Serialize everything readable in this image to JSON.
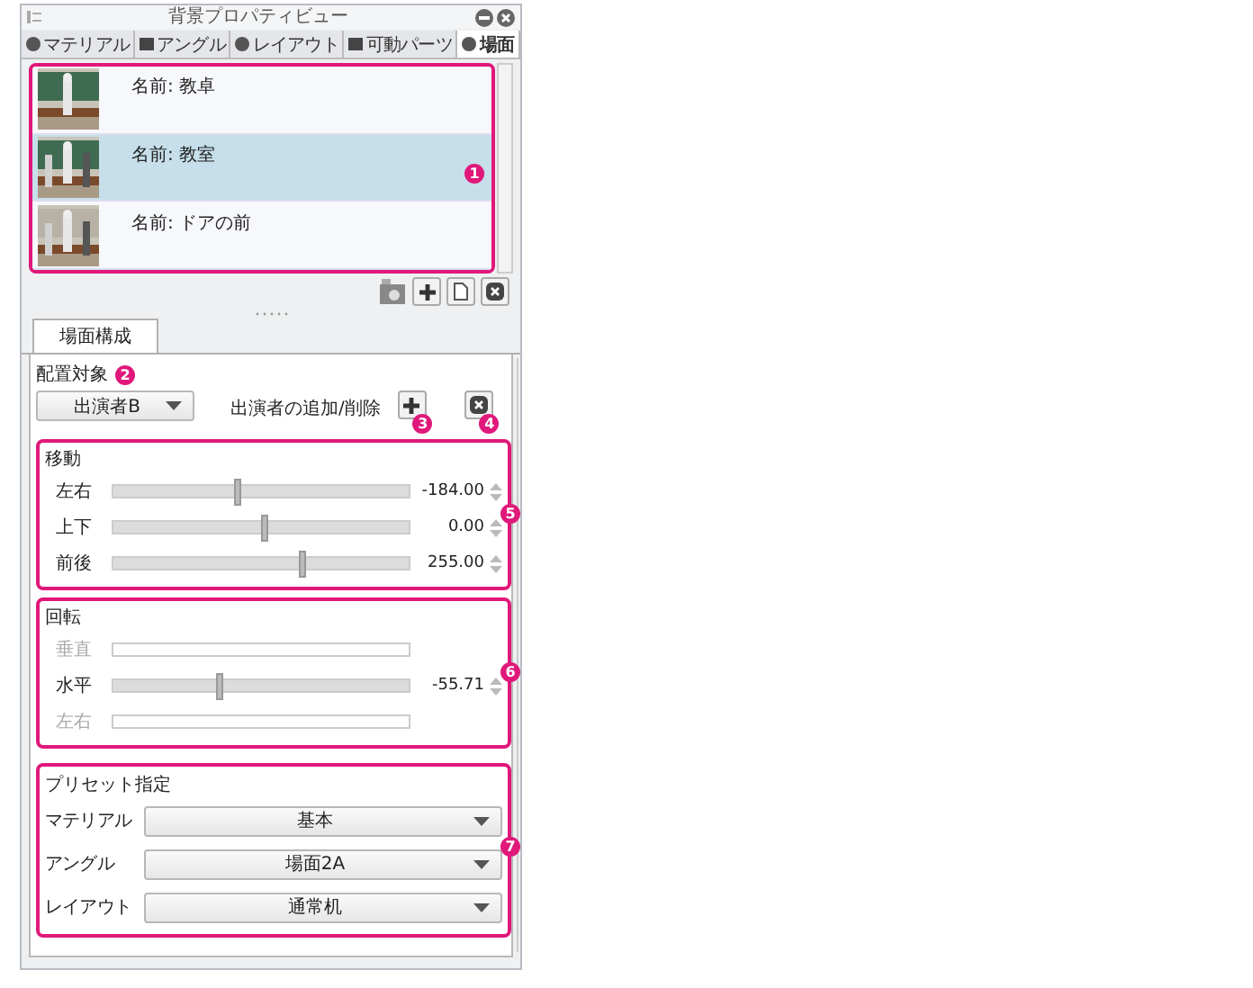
{
  "window": {
    "title": "背景プロパティビュー"
  },
  "tabs": [
    {
      "label": "マテリアル",
      "selected": false
    },
    {
      "label": "アングル",
      "selected": false
    },
    {
      "label": "レイアウト",
      "selected": false
    },
    {
      "label": "可動パーツ",
      "selected": false
    },
    {
      "label": "場面",
      "selected": true
    }
  ],
  "scene_list": {
    "callout": "1",
    "items": [
      {
        "name": "名前: 教卓",
        "selected": false
      },
      {
        "name": "名前: 教室",
        "selected": true
      },
      {
        "name": "名前: ドアの前",
        "selected": false
      }
    ]
  },
  "section_tab": {
    "label": "場面構成"
  },
  "placement": {
    "label": "配置対象",
    "callout": "2",
    "performer": "出演者B",
    "add_remove_label": "出演者の追加/削除",
    "add_callout": "3",
    "remove_callout": "4"
  },
  "groups": [
    {
      "title": "移動",
      "callout": "5",
      "sliders": [
        {
          "label": "左右",
          "disabled": false,
          "level": 0.41,
          "value": "-184.00"
        },
        {
          "label": "上下",
          "disabled": false,
          "level": 0.5,
          "value": "0.00"
        },
        {
          "label": "前後",
          "disabled": false,
          "level": 0.63,
          "value": "255.00"
        }
      ]
    },
    {
      "title": "回転",
      "callout": "6",
      "sliders": [
        {
          "label": "垂直",
          "disabled": true
        },
        {
          "label": "水平",
          "disabled": false,
          "level": 0.35,
          "value": "-55.71"
        },
        {
          "label": "左右",
          "disabled": true
        }
      ]
    }
  ],
  "preset": {
    "title": "プリセット指定",
    "callout": "7",
    "rows": [
      {
        "label": "マテリアル",
        "value": "基本"
      },
      {
        "label": "アングル",
        "value": "場面2A"
      },
      {
        "label": "レイアウト",
        "value": "通常机"
      }
    ]
  }
}
